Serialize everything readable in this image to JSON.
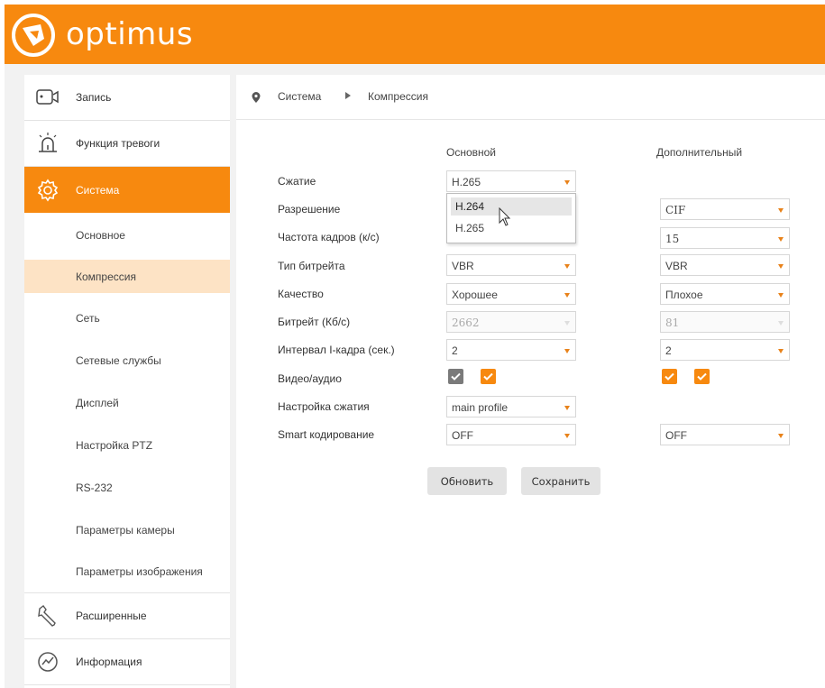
{
  "brand": {
    "name": "optimus",
    "color": "#f7890f"
  },
  "sidebar": {
    "items": [
      {
        "label": "Запись",
        "icon": "camera-icon"
      },
      {
        "label": "Функция тревоги",
        "icon": "alarm-icon"
      },
      {
        "label": "Система",
        "icon": "gear-icon"
      },
      {
        "label": "Расширенные",
        "icon": "wrench-icon"
      },
      {
        "label": "Информация",
        "icon": "chart-info-icon"
      }
    ],
    "subitems": [
      {
        "label": "Основное"
      },
      {
        "label": "Компрессия"
      },
      {
        "label": "Сеть"
      },
      {
        "label": "Сетевые службы"
      },
      {
        "label": "Дисплей"
      },
      {
        "label": "Настройка PTZ"
      },
      {
        "label": "RS-232"
      },
      {
        "label": "Параметры камеры"
      },
      {
        "label": "Параметры изображения"
      }
    ]
  },
  "breadcrumb": {
    "level1": "Система",
    "level2": "Компрессия"
  },
  "form": {
    "col_main": "Основной",
    "col_extra": "Дополнительный",
    "labels": {
      "compression": "Сжатие",
      "resolution": "Разрешение",
      "framerate": "Частота кадров (к/с)",
      "bitrate_type": "Тип битрейта",
      "quality": "Качество",
      "bitrate": "Битрейт (Кб/с)",
      "iframe_interval": "Интервал I-кадра (сек.)",
      "video_audio": "Видео/аудио",
      "compression_setting": "Настройка сжатия",
      "smart_coding": "Smart кодирование"
    },
    "main": {
      "compression": "H.265",
      "bitrate_type": "VBR",
      "quality": "Хорошее",
      "bitrate": "2662",
      "iframe_interval": "2",
      "video_checked": true,
      "audio_checked": true,
      "compression_setting": "main profile",
      "smart_coding": "OFF"
    },
    "extra": {
      "resolution": "CIF",
      "framerate": "15",
      "bitrate_type": "VBR",
      "quality": "Плохое",
      "bitrate": "81",
      "iframe_interval": "2",
      "video_checked": true,
      "audio_checked": true,
      "smart_coding": "OFF"
    },
    "dropdown_options": [
      "H.264",
      "H.265"
    ]
  },
  "buttons": {
    "refresh": "Обновить",
    "save": "Сохранить"
  }
}
